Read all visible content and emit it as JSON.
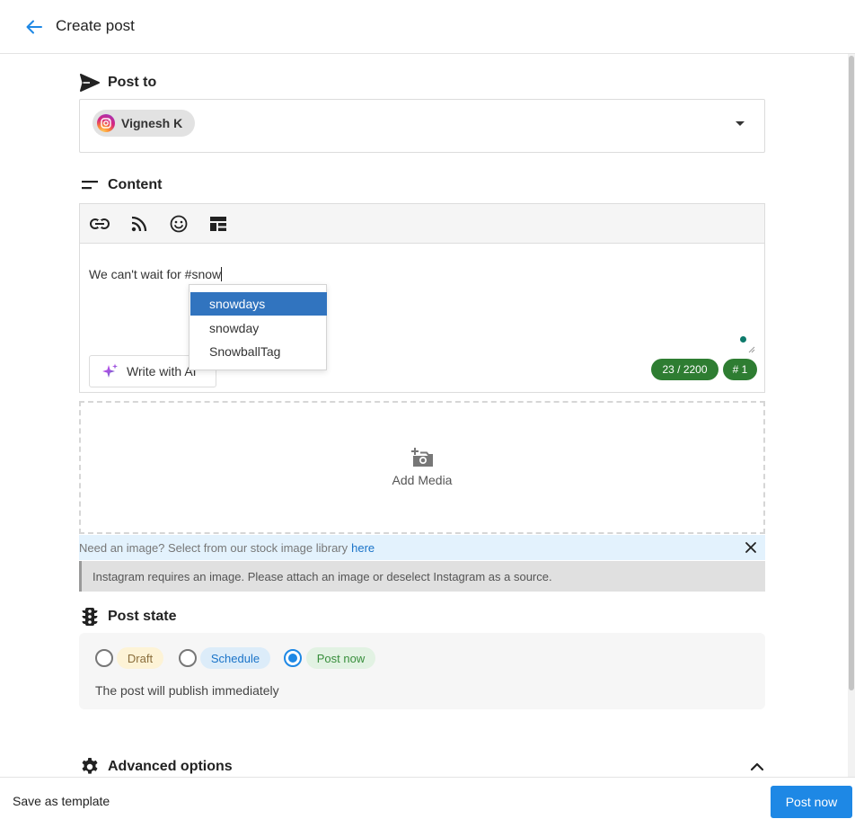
{
  "header": {
    "title": "Create post"
  },
  "post_to": {
    "heading": "Post to",
    "account": {
      "name": "Vignesh K",
      "network_icon": "instagram-icon"
    }
  },
  "content": {
    "heading": "Content",
    "toolbar": [
      "link-icon",
      "rss-icon",
      "emoji-icon",
      "layout-icon"
    ],
    "text": "We can't wait for #snow",
    "ai_button": "Write with AI",
    "char_count": "23 / 2200",
    "hashtag_count": "# 1",
    "suggestions": [
      "snowdays",
      "snowday",
      "SnowballTag"
    ]
  },
  "media": {
    "add_label": "Add Media",
    "stock_text": "Need an image? Select from our stock image library",
    "stock_link": "here",
    "warning": "Instagram requires an image. Please attach an image or deselect Instagram as a source."
  },
  "post_state": {
    "heading": "Post state",
    "options": [
      {
        "label": "Draft",
        "checked": false
      },
      {
        "label": "Schedule",
        "checked": false
      },
      {
        "label": "Post now",
        "checked": true
      }
    ],
    "description": "The post will publish immediately"
  },
  "advanced": {
    "heading": "Advanced options"
  },
  "footer": {
    "save_template": "Save as template",
    "post_now": "Post now"
  },
  "colors": {
    "primary": "#1e88e5",
    "success": "#2e7d32",
    "suggest_active": "#3174bf"
  }
}
